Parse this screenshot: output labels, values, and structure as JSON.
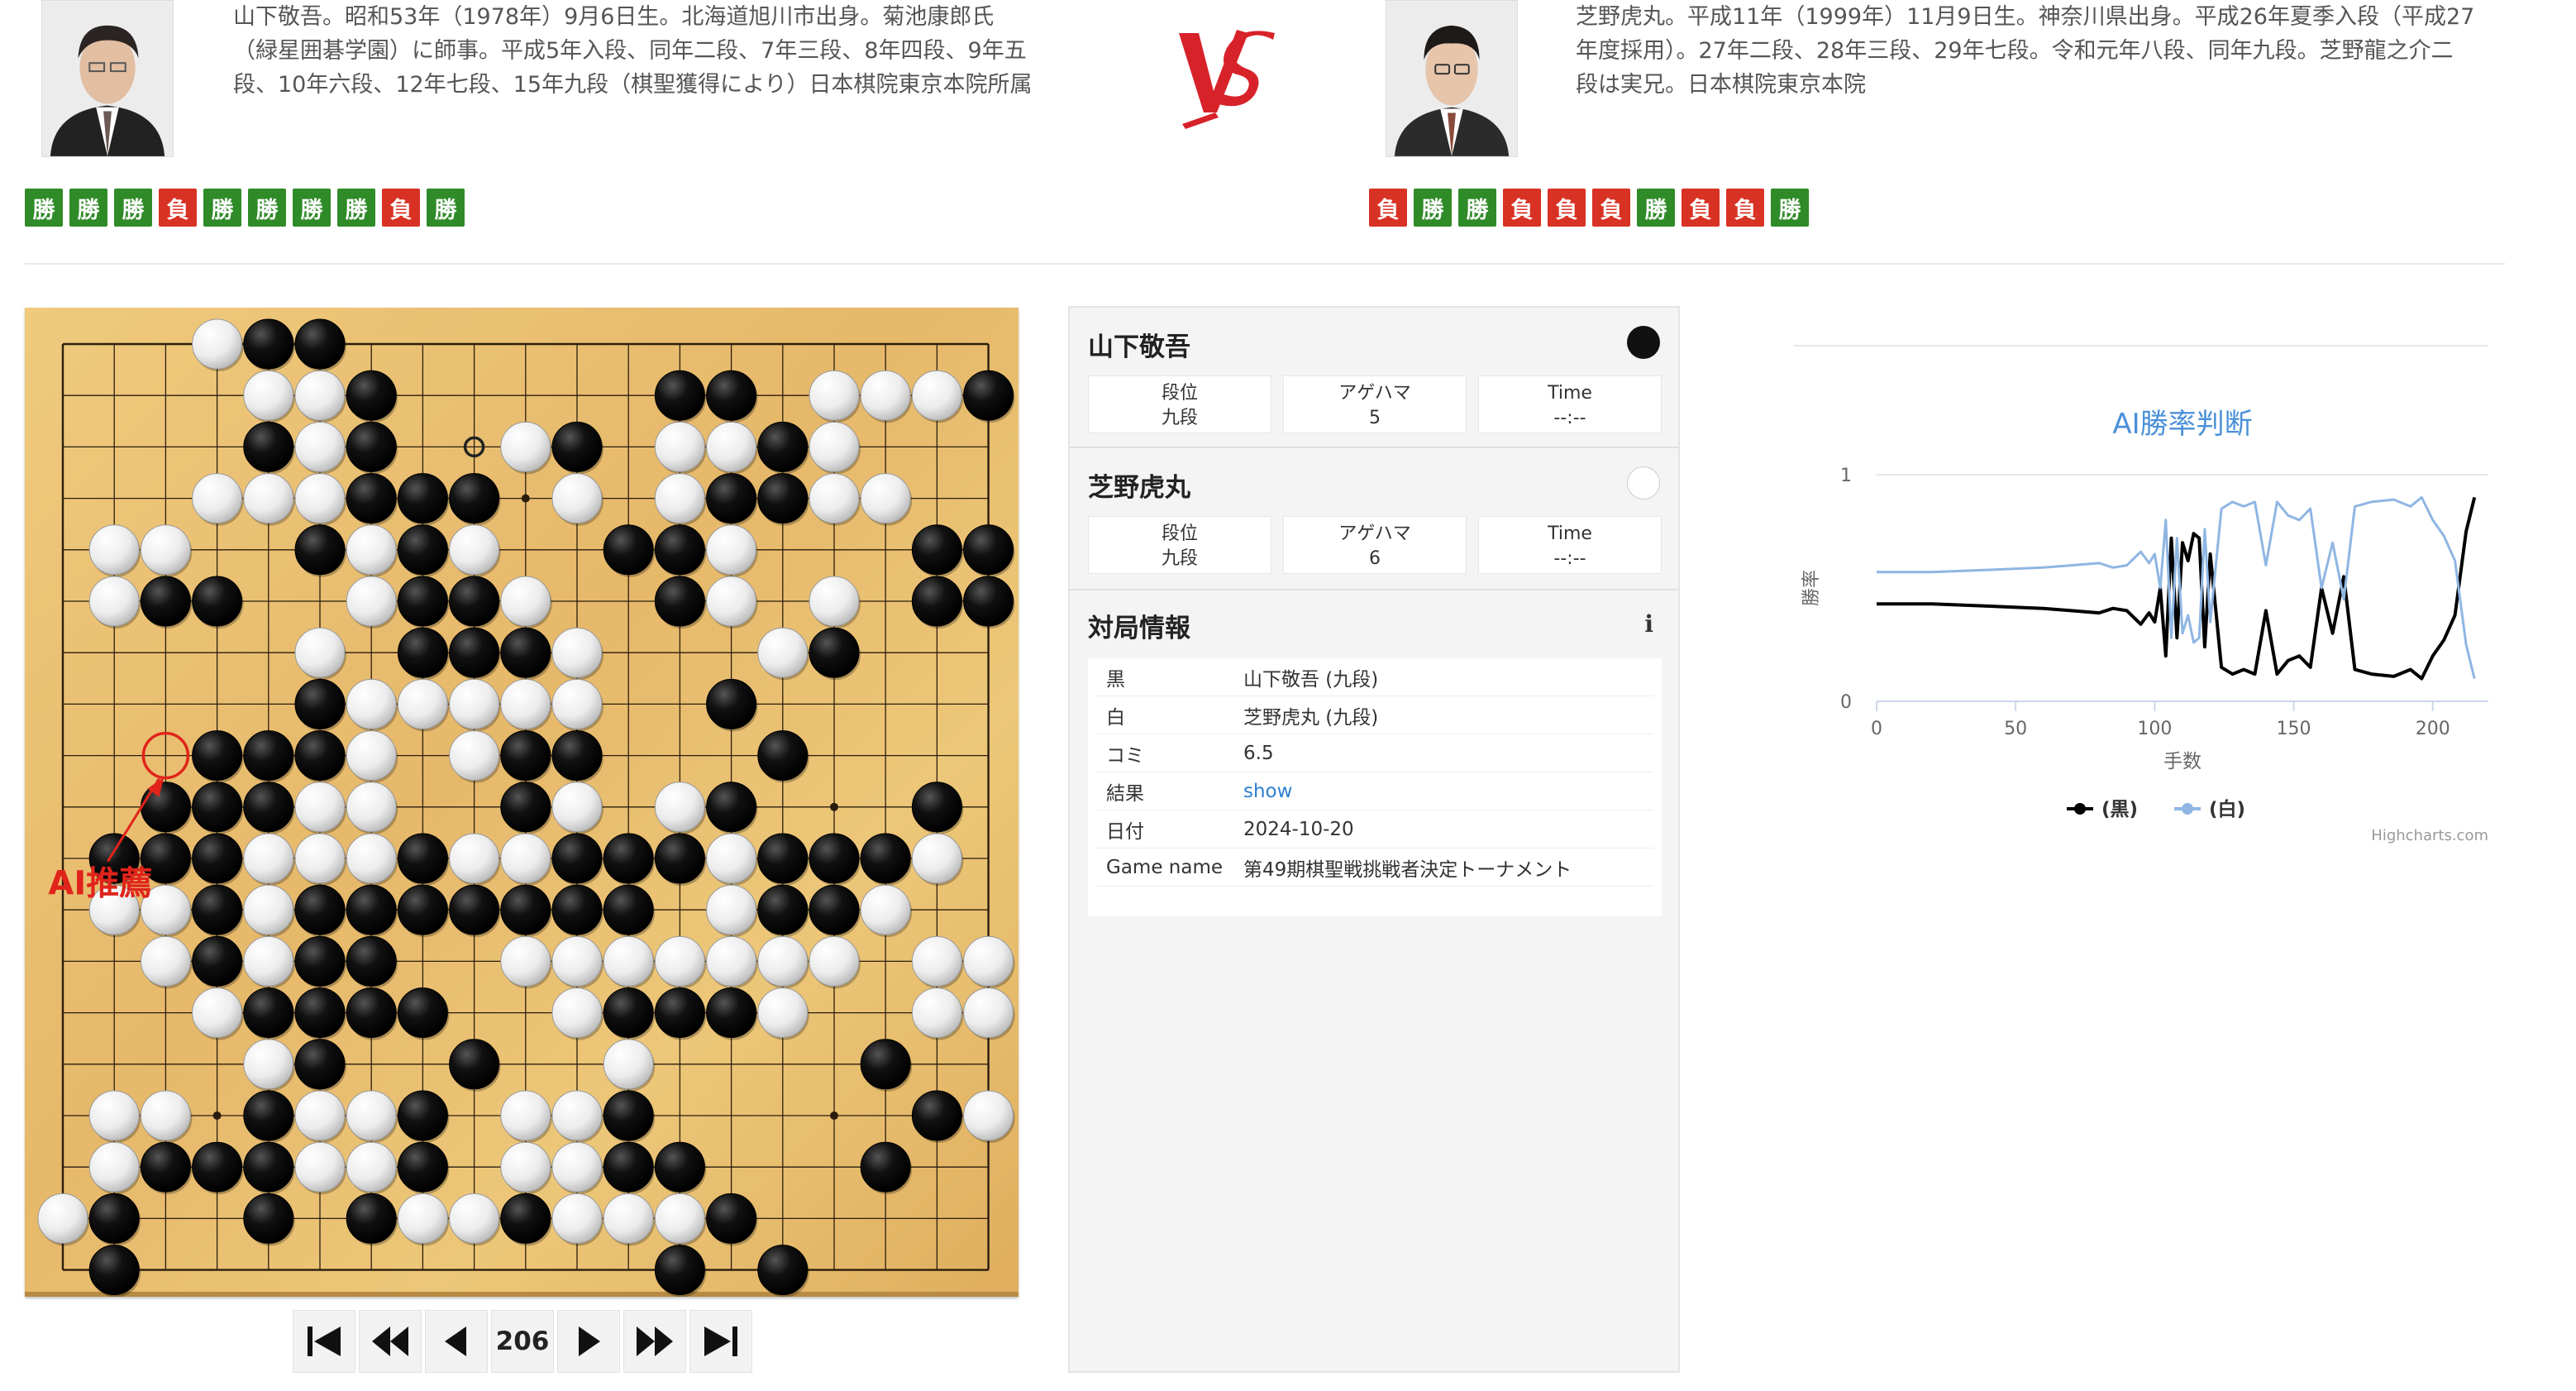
{
  "black_player": {
    "name": "山下敬吾",
    "bio": [
      "山下敬吾。昭和53年（1978年）9月6日生。北海道旭川市出身。菊池康郎氏",
      "（緑星囲碁学園）に師事。平成5年入段、同年二段、7年三段、8年四段、9年五",
      "段、10年六段、12年七段、15年九段（棋聖獲得により）日本棋院東京本院所属"
    ],
    "record": [
      "勝",
      "勝",
      "勝",
      "負",
      "勝",
      "勝",
      "勝",
      "勝",
      "負",
      "勝"
    ],
    "dan_label": "段位",
    "dan": "九段",
    "agehama_label": "アゲハマ",
    "agehama": "5",
    "time_label": "Time",
    "time": "--:--"
  },
  "white_player": {
    "name": "芝野虎丸",
    "bio": [
      "芝野虎丸。平成11年（1999年）11月9日生。神奈川県出身。平成26年夏季入段（平成27",
      "年度採用）。27年二段、28年三段、29年七段。令和元年八段、同年九段。芝野龍之介二",
      "段は実兄。日本棋院東京本院"
    ],
    "record": [
      "負",
      "勝",
      "勝",
      "負",
      "負",
      "負",
      "勝",
      "負",
      "負",
      "勝"
    ],
    "dan_label": "段位",
    "dan": "九段",
    "agehama_label": "アゲハマ",
    "agehama": "6",
    "time_label": "Time",
    "time": "--:--"
  },
  "colors": {
    "win": "#2f8b27",
    "loss": "#d83224",
    "vs": "#d8222a",
    "link": "#2b7fd1",
    "chart_title": "#4a90d9",
    "white_series": "#8fb6e3"
  },
  "board": {
    "size": 19,
    "move_number": "206",
    "ai_label": "AI推薦",
    "ai_point": "C11",
    "last_move": "J17",
    "stones": [
      "...wbb.............",
      "....wwb.....bb.wwwbw",
      "....bwb..wb.wwbw...w",
      "...wwwbbb.w.wbbww..",
      ".ww..bwbw..bbw...bb",
      ".wbb..wbbw..bw.w.bb.",
      ".....w.bbbw...wb....",
      ".....bwwwww..b......",
      "...bbbw.wbb...b.....",
      "..bbbww..bw.wb...b..",
      ".bbbwwwbwwbbbwbbbw..",
      ".wwbwbbbbbbb.wbbw...",
      "..wbwbb..wwwwwww.ww.",
      "...wbbbb..wbbbw..ww..",
      "....wb..b..w....b...",
      ".ww.bwwb.wwb.....bw..",
      ".wbbbwwb.wwbb...b.....",
      "wb..b.bwwbwwwb.....bb.",
      ".b..........b.b......"
    ],
    "nav": [
      "first-icon",
      "rewind-icon",
      "prev-icon",
      "next-icon",
      "fast-forward-icon",
      "last-icon"
    ]
  },
  "game_info": {
    "title": "対局情報",
    "rows": [
      {
        "label": "黒",
        "value": "山下敬吾 (九段)"
      },
      {
        "label": "白",
        "value": "芝野虎丸 (九段)"
      },
      {
        "label": "コミ",
        "value": "6.5"
      },
      {
        "label": "結果",
        "value": "show"
      },
      {
        "label": "日付",
        "value": "2024-10-20"
      },
      {
        "label": "Game name",
        "value": "第49期棋聖戦挑戦者決定トーナメント"
      }
    ]
  },
  "chart_data": {
    "type": "line",
    "title": "AI勝率判断",
    "xlabel": "手数",
    "ylabel": "勝率",
    "xlim": [
      0,
      220
    ],
    "ylim": [
      0,
      1
    ],
    "x_ticks": [
      "0",
      "50",
      "100",
      "150",
      "200"
    ],
    "y_ticks": [
      "0",
      "1"
    ],
    "grid": true,
    "legend": "bottom-center",
    "credit": "Highcharts.com",
    "series": [
      {
        "name": "(黒)",
        "color": "#000000",
        "points": [
          [
            0,
            0.43
          ],
          [
            20,
            0.43
          ],
          [
            40,
            0.42
          ],
          [
            60,
            0.41
          ],
          [
            70,
            0.4
          ],
          [
            80,
            0.39
          ],
          [
            85,
            0.41
          ],
          [
            90,
            0.4
          ],
          [
            95,
            0.34
          ],
          [
            98,
            0.39
          ],
          [
            100,
            0.35
          ],
          [
            102,
            0.5
          ],
          [
            104,
            0.2
          ],
          [
            106,
            0.72
          ],
          [
            108,
            0.28
          ],
          [
            110,
            0.7
          ],
          [
            112,
            0.62
          ],
          [
            114,
            0.74
          ],
          [
            116,
            0.72
          ],
          [
            118,
            0.24
          ],
          [
            120,
            0.65
          ],
          [
            124,
            0.15
          ],
          [
            128,
            0.12
          ],
          [
            132,
            0.14
          ],
          [
            136,
            0.12
          ],
          [
            140,
            0.4
          ],
          [
            144,
            0.12
          ],
          [
            148,
            0.18
          ],
          [
            152,
            0.2
          ],
          [
            156,
            0.15
          ],
          [
            160,
            0.5
          ],
          [
            164,
            0.3
          ],
          [
            168,
            0.55
          ],
          [
            172,
            0.14
          ],
          [
            178,
            0.12
          ],
          [
            186,
            0.11
          ],
          [
            192,
            0.14
          ],
          [
            196,
            0.1
          ],
          [
            200,
            0.2
          ],
          [
            204,
            0.27
          ],
          [
            208,
            0.38
          ],
          [
            212,
            0.75
          ],
          [
            215,
            0.9
          ]
        ]
      },
      {
        "name": "(白)",
        "color": "#8fb6e3",
        "points": [
          [
            0,
            0.57
          ],
          [
            20,
            0.57
          ],
          [
            40,
            0.58
          ],
          [
            60,
            0.59
          ],
          [
            70,
            0.6
          ],
          [
            80,
            0.61
          ],
          [
            85,
            0.59
          ],
          [
            90,
            0.6
          ],
          [
            95,
            0.66
          ],
          [
            98,
            0.61
          ],
          [
            100,
            0.65
          ],
          [
            102,
            0.5
          ],
          [
            104,
            0.8
          ],
          [
            106,
            0.28
          ],
          [
            108,
            0.72
          ],
          [
            110,
            0.3
          ],
          [
            112,
            0.38
          ],
          [
            114,
            0.26
          ],
          [
            116,
            0.28
          ],
          [
            118,
            0.76
          ],
          [
            120,
            0.35
          ],
          [
            124,
            0.85
          ],
          [
            128,
            0.88
          ],
          [
            132,
            0.86
          ],
          [
            136,
            0.88
          ],
          [
            140,
            0.6
          ],
          [
            144,
            0.88
          ],
          [
            148,
            0.82
          ],
          [
            152,
            0.8
          ],
          [
            156,
            0.85
          ],
          [
            160,
            0.5
          ],
          [
            164,
            0.7
          ],
          [
            168,
            0.45
          ],
          [
            172,
            0.86
          ],
          [
            178,
            0.88
          ],
          [
            186,
            0.89
          ],
          [
            192,
            0.86
          ],
          [
            196,
            0.9
          ],
          [
            200,
            0.8
          ],
          [
            204,
            0.73
          ],
          [
            208,
            0.62
          ],
          [
            212,
            0.25
          ],
          [
            215,
            0.1
          ]
        ]
      }
    ]
  }
}
